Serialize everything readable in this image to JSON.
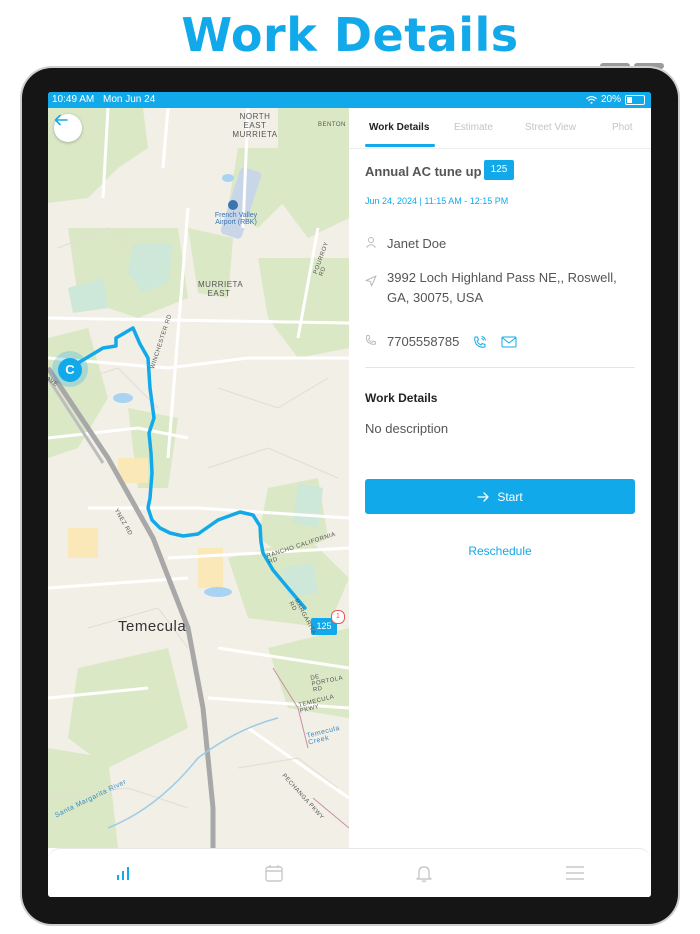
{
  "headline": "Work Details",
  "status_bar": {
    "time": "10:49 AM",
    "date": "Mon Jun 24",
    "battery": "20%"
  },
  "map": {
    "labels": {
      "north_east_murrieta": "NORTH EAST MURRIETA",
      "benton": "BENTON",
      "airport": "French Valley Airport (RBK)",
      "murrieta_east": "MURRIETA EAST",
      "temecula": "Temecula",
      "winchester": "WINCHESTER RD",
      "rancho": "RANCHO CALIFORNIA RD",
      "pourroy": "POURROY RD",
      "pechanga": "PECHANGA PKWY",
      "margarita": "MARGARITA RD",
      "depo": "DE PORTOLA RD",
      "temecula_pkwy": "TEMECULA PKWY",
      "temecula_creek": "Temecula Creek",
      "santa_margarita_river": "Santa Margarita River",
      "ynez": "YNEZ RD",
      "ave": "AVE"
    },
    "start_marker": "C",
    "end_marker": "125",
    "end_marker_count": "1"
  },
  "tabs": [
    {
      "label": "Work Details",
      "active": true
    },
    {
      "label": "Estimate",
      "active": false
    },
    {
      "label": "Street View",
      "active": false
    },
    {
      "label": "Phot",
      "active": false
    }
  ],
  "job": {
    "title": "Annual AC tune up",
    "badge": "125",
    "time": "Jun 24, 2024 | 11:15 AM - 12:15 PM",
    "customer": "Janet Doe",
    "address": "3992 Loch Highland Pass NE,, Roswell, GA, 30075, USA",
    "phone": "7705558785"
  },
  "work_details": {
    "title": "Work Details",
    "description": "No description"
  },
  "actions": {
    "start": "Start",
    "reschedule": "Reschedule"
  },
  "bottom_nav": [
    "chart-icon",
    "calendar-icon",
    "bell-icon",
    "menu-icon"
  ],
  "colors": {
    "accent": "#12a9ea"
  }
}
